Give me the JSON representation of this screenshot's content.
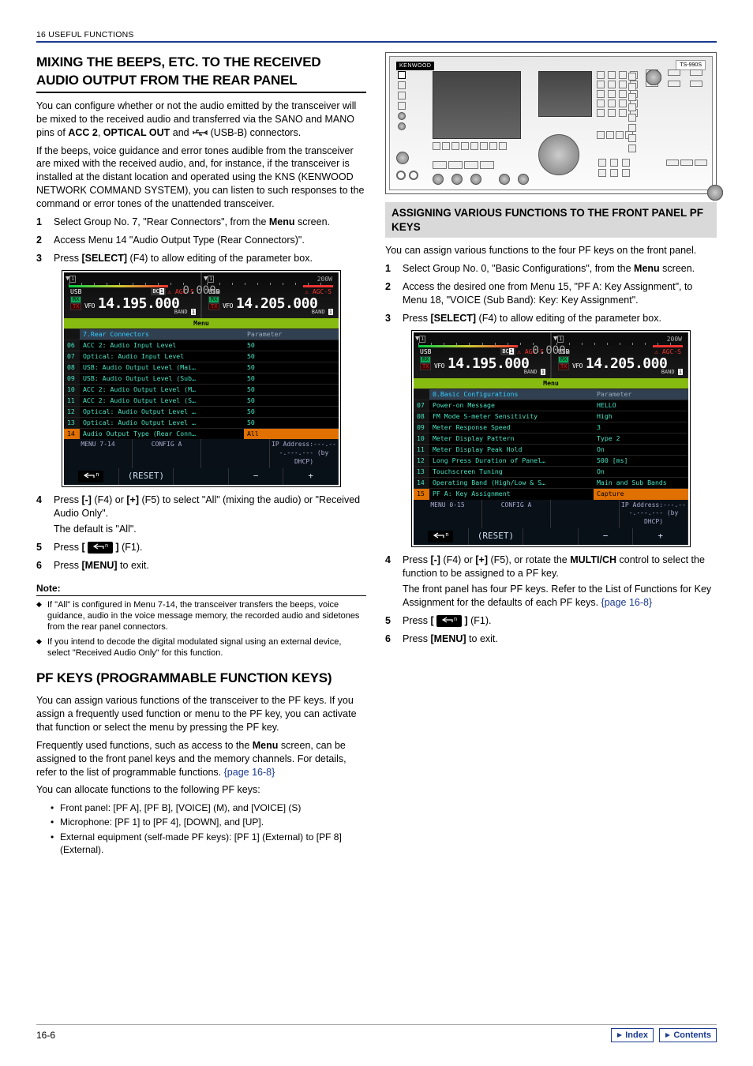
{
  "header": {
    "text": "16 USEFUL FUNCTIONS"
  },
  "footer": {
    "page": "16-6",
    "btn_index": "Index",
    "btn_contents": "Contents"
  },
  "left": {
    "h1a": "MIXING THE BEEPS, ETC. TO THE RECEIVED",
    "h1b": "AUDIO OUTPUT FROM THE REAR PANEL",
    "p1a": "You can configure whether or not the audio emitted by the transceiver will be mixed to the received audio and transferred via the SANO and MANO pins of ",
    "p1b": "ACC 2",
    "p1c": ", ",
    "p1d": "OPTICAL OUT",
    "p1e": " and ",
    "p1f": " (USB-B) connectors.",
    "p2": "If the beeps, voice guidance and error tones audible from the transceiver are mixed with the received audio, and, for instance, if the transceiver is installed at the distant location and operated using the KNS (KENWOOD NETWORK COMMAND SYSTEM), you can listen to such responses to the command or error tones of the unattended transceiver.",
    "steps1": [
      {
        "n": "1",
        "txt_a": "Select Group No. 7, \"Rear Connectors\", from the ",
        "b": "Menu",
        "txt_b": " screen."
      },
      {
        "n": "2",
        "txt_a": "Access Menu 14 \"Audio Output Type (Rear Connectors)\"."
      },
      {
        "n": "3",
        "txt_a": "Press ",
        "b": "[SELECT]",
        "txt_b": " (F4) to allow editing of the parameter box."
      }
    ],
    "steps2": [
      {
        "n": "4",
        "txt_a": "Press ",
        "b": "[-]",
        "mid": " (F4) or ",
        "b2": "[+]",
        "txt_b": " (F5) to select \"All\" (mixing the audio) or \"Received Audio Only\".",
        "line2": "The default is \"All\"."
      },
      {
        "n": "5",
        "txt_a": "Press ",
        "b": "[",
        "txt_b": " (F1).",
        "b2": "]",
        "icon": true
      },
      {
        "n": "6",
        "txt_a": "Press ",
        "b": "[MENU]",
        "txt_b": " to exit."
      }
    ],
    "note_hd": "Note:",
    "notes": [
      "If \"All\" is configured in Menu 7-14, the transceiver transfers the beeps, voice guidance, audio in the voice message memory, the recorded audio and sidetones from the rear panel connectors.",
      "If you intend to decode the digital modulated signal using an external device, select \"Received Audio Only\" for this function."
    ],
    "h2": "PF KEYS (PROGRAMMABLE FUNCTION KEYS)",
    "p3": "You can assign various functions of the transceiver to the PF keys. If you assign a frequently used function or menu to the PF key, you can activate that function or select the menu by pressing the PF key.",
    "p4a": "Frequently used functions, such as access to the ",
    "p4b": "Menu",
    "p4c": " screen, can be assigned to the front panel keys and the memory channels. For details, refer to the list of programmable functions.  ",
    "p4link": "{page 16-8}",
    "p5": "You can allocate functions to the following PF keys:",
    "bul": [
      "Front panel: [PF A], [PF B], [VOICE] (M), and [VOICE] (S)",
      "Microphone: [PF 1] to [PF 4], [DOWN], and [UP].",
      "External equipment (self-made PF keys): [PF 1] (External) to [PF 8] (External)."
    ]
  },
  "right": {
    "h3": "ASSIGNING VARIOUS FUNCTIONS TO THE FRONT PANEL PF KEYS",
    "p1": "You can assign various functions to the four PF keys on the front panel.",
    "steps1": [
      {
        "n": "1",
        "txt_a": "Select Group No. 0, \"Basic Configurations\", from the ",
        "b": "Menu",
        "txt_b": " screen."
      },
      {
        "n": "2",
        "txt_a": "Access the desired one from Menu 15, \"PF A: Key Assignment\", to Menu 18, \"VOICE (Sub Band): Key: Key Assignment\"."
      },
      {
        "n": "3",
        "txt_a": "Press ",
        "b": "[SELECT]",
        "txt_b": " (F4) to allow editing of the parameter box."
      }
    ],
    "steps2": [
      {
        "n": "4",
        "txt_a": "Press ",
        "b": "[-]",
        "mid": " (F4) or ",
        "b2": "[+]",
        "txt_b": " (F5), or rotate the ",
        "b3": "MULTI/CH",
        "txt_c": " control to select the function to be assigned to a PF key.",
        "line2": "The front panel has four PF keys. Refer to the List of Functions for Key Assignment for the defaults of each PF keys. ",
        "link": "{page 16-8}"
      },
      {
        "n": "5",
        "txt_a": "Press ",
        "b": "[",
        "txt_b": " (F1).",
        "b2": "]",
        "icon": true
      },
      {
        "n": "6",
        "txt_a": "Press ",
        "b": "[MENU]",
        "txt_b": " to exit."
      }
    ]
  },
  "menushot1": {
    "f1": "14.195.000",
    "f2": "14.205.000",
    "pow": "200W",
    "zero": "0.000",
    "mhdr": "Menu",
    "grp": "7.Rear Connectors",
    "phead": "Parameter",
    "rows": [
      {
        "id": "06",
        "lab": "ACC 2: Audio Input Level",
        "val": "50"
      },
      {
        "id": "07",
        "lab": "Optical: Audio Input Level",
        "val": "50"
      },
      {
        "id": "08",
        "lab": "USB: Audio Output Level (Mai…",
        "val": "50"
      },
      {
        "id": "09",
        "lab": "USB: Audio Output Level (Sub…",
        "val": "50"
      },
      {
        "id": "10",
        "lab": "ACC 2: Audio Output Level (M…",
        "val": "50"
      },
      {
        "id": "11",
        "lab": "ACC 2: Audio Output Level (S…",
        "val": "50"
      },
      {
        "id": "12",
        "lab": "Optical: Audio Output Level …",
        "val": "50"
      },
      {
        "id": "13",
        "lab": "Optical: Audio Output Level …",
        "val": "50"
      },
      {
        "id": "14",
        "lab": "Audio Output Type (Rear Conn…",
        "val": "All",
        "sel": true
      }
    ],
    "foot": [
      "MENU 7-14",
      "CONFIG A",
      "",
      "IP Address:---.---.---.--- (by DHCP)"
    ],
    "foot2": [
      "⮐",
      "(RESET)",
      "",
      "−",
      "+"
    ]
  },
  "menushot2": {
    "f1": "14.195.000",
    "f2": "14.205.000",
    "pow": "200W",
    "zero": "0.000",
    "mhdr": "Menu",
    "grp": "0.Basic Configurations",
    "phead": "Parameter",
    "rows": [
      {
        "id": "07",
        "lab": "Power-on Message",
        "val": "HELLO"
      },
      {
        "id": "08",
        "lab": "FM Mode S-meter Sensitivity",
        "val": "High"
      },
      {
        "id": "09",
        "lab": "Meter Response Speed",
        "val": "3"
      },
      {
        "id": "10",
        "lab": "Meter Display Pattern",
        "val": "Type 2"
      },
      {
        "id": "11",
        "lab": "Meter Display Peak Hold",
        "val": "On"
      },
      {
        "id": "12",
        "lab": "Long Press Duration of Panel…",
        "val": "500 [ms]"
      },
      {
        "id": "13",
        "lab": "Touchscreen Tuning",
        "val": "On"
      },
      {
        "id": "14",
        "lab": "Operating Band (High/Low & S…",
        "val": "Main and Sub Bands"
      },
      {
        "id": "15",
        "lab": "PF A: Key Assignment",
        "val": "Capture",
        "sel": true
      }
    ],
    "foot": [
      "MENU 0-15",
      "CONFIG A",
      "",
      "IP Address:---.---.---.--- (by DHCP)"
    ],
    "foot2": [
      "⮐",
      "(RESET)",
      "",
      "−",
      "+"
    ]
  }
}
